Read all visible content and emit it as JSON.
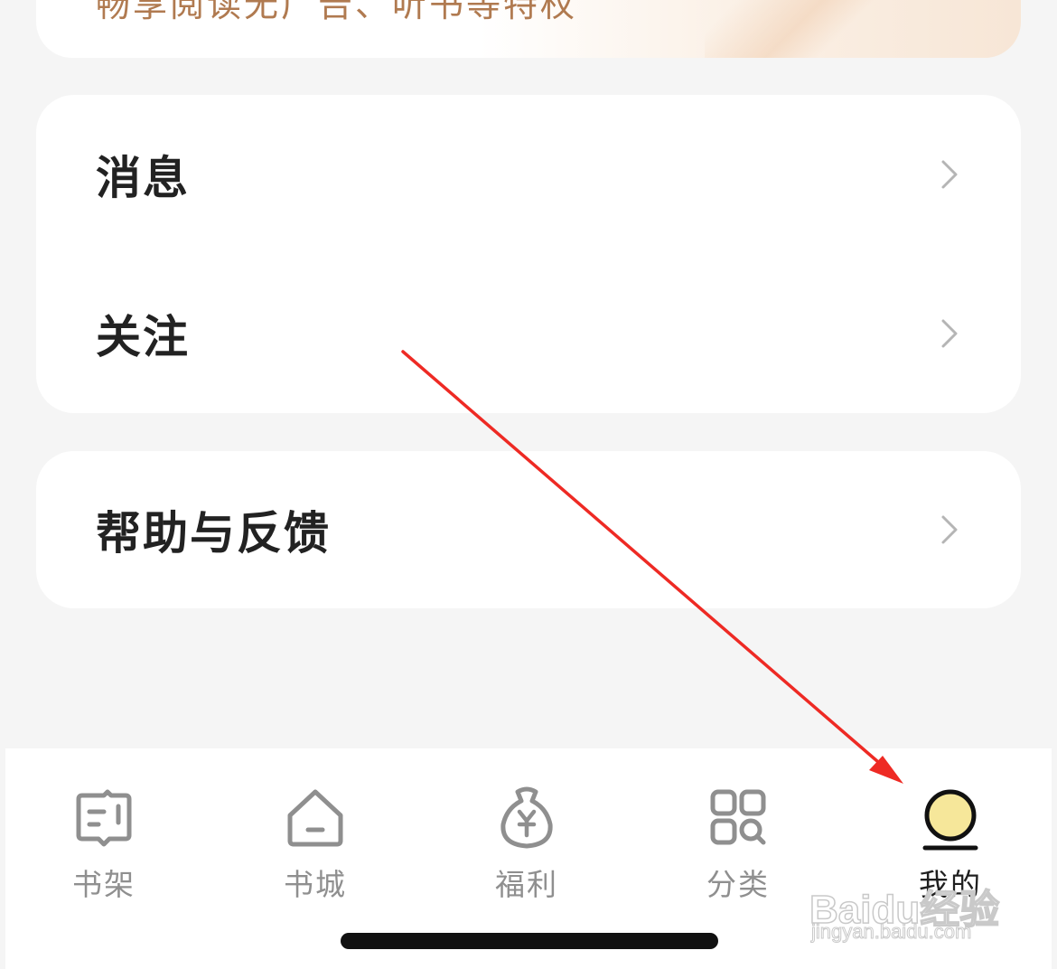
{
  "promo": {
    "text": "畅享阅读无广告、听书等特权"
  },
  "menu": {
    "messages_label": "消息",
    "follow_label": "关注",
    "help_label": "帮助与反馈"
  },
  "tabbar": {
    "tabs": [
      {
        "label": "书架",
        "icon": "bookshelf-icon",
        "active": false
      },
      {
        "label": "书城",
        "icon": "home-icon",
        "active": false
      },
      {
        "label": "福利",
        "icon": "money-bag-icon",
        "active": false
      },
      {
        "label": "分类",
        "icon": "category-grid-icon",
        "active": false
      },
      {
        "label": "我的",
        "icon": "profile-avatar-icon",
        "active": true
      }
    ]
  },
  "colors": {
    "background": "#f5f5f5",
    "card": "#ffffff",
    "label": "#222222",
    "inactive_tab": "#8f8f8f",
    "active_tab": "#1f1f1f",
    "avatar_fill": "#f6e79a",
    "annotation_arrow": "#ee2a24",
    "promo_text": "#b07a50"
  },
  "watermark": {
    "brand": "Baidu经验",
    "url": "jingyan.baidu.com"
  }
}
